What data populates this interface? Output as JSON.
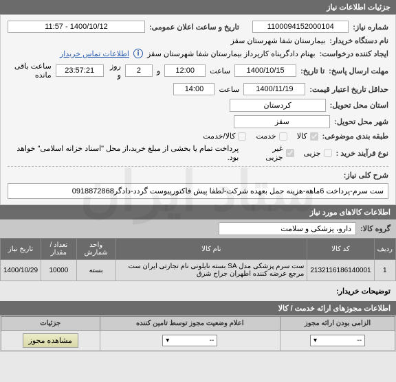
{
  "header": {
    "title": "جزئیات اطلاعات نیاز"
  },
  "info": {
    "reqnum_label": "شماره نیاز:",
    "reqnum": "1100094152000104",
    "public_date_label": "تاریخ و ساعت اعلان عمومی:",
    "public_date": "1400/10/12 - 11:57",
    "buyer_label": "نام دستگاه خریدار:",
    "buyer": "بیمارستان شفا شهرستان سقز",
    "requester_label": "ایجاد کننده درخواست:",
    "requester": "بهنام دادگرپناه کارپرداز بیمارستان شفا شهرستان سقز",
    "contact_link": "اطلاعات تماس خریدار",
    "reply_deadline_label": "مهلت ارسال پاسخ:",
    "until_label": "تا تاریخ:",
    "date1": "1400/10/15",
    "time_label": "ساعت",
    "time1": "12:00",
    "and_label": "و",
    "day_count": "2",
    "day_label": "روز و",
    "remaining": "23:57:21",
    "remaining_label": "ساعت باقی مانده",
    "price_valid_label": "حداقل تاریخ اعتبار قیمت:",
    "date2": "1400/11/19",
    "time2": "14:00",
    "province_label": "استان محل تحویل:",
    "province": "کردستان",
    "city_label": "شهر محل تحویل:",
    "city": "سقز",
    "category_label": "طبقه بندی موضوعی:",
    "cb_kala": "کالا",
    "cb_khadamat": "خدمت",
    "cb_mixed": "کالا/خدمت",
    "process_label": "نوع فرآیند خرید :",
    "cb_jozi": "جزیی",
    "cb_non_jozi": "غیر جزیی",
    "process_note": "پرداخت تمام یا بخشی از مبلغ خرید،از محل \"اسناد خزانه اسلامی\" خواهد بود."
  },
  "desc": {
    "title_label": "شرح کلی نیاز:",
    "title_text": "ست سرم-پرداخت 6ماهه-هزینه حمل بعهده شرکت-لطفا پیش فاکتورپیوست گردد-دادگر0918872868"
  },
  "items_header": "اطلاعات کالاهای مورد نیاز",
  "group": {
    "label": "گروه کالا:",
    "value": "دارو، پزشکی و سلامت"
  },
  "table": {
    "headers": [
      "ردیف",
      "کد کالا",
      "نام کالا",
      "واحد شمارش",
      "تعداد / مقدار",
      "تاریخ نیاز"
    ],
    "rows": [
      {
        "idx": "1",
        "code": "2132116186140001",
        "name": "ست سرم پزشکی مدل SA بسته نایلونی نام تجارتی ایران ست مرجع عرضه کننده اطهران جراح شرق",
        "unit": "بسته",
        "qty": "10000",
        "date": "1400/10/29"
      }
    ]
  },
  "buyer_note_label": "توضیحات خریدار:",
  "perm_header": "اطلاعات مجوزهای ارائه خدمت / کالا",
  "perm_table": {
    "headers": [
      "الزامی بودن ارائه مجوز",
      "اعلام وضعیت مجوز توسط تامین کننده",
      "جزئیات"
    ],
    "row": {
      "req": "--",
      "status": "--",
      "btn": "مشاهده مجوز"
    }
  }
}
